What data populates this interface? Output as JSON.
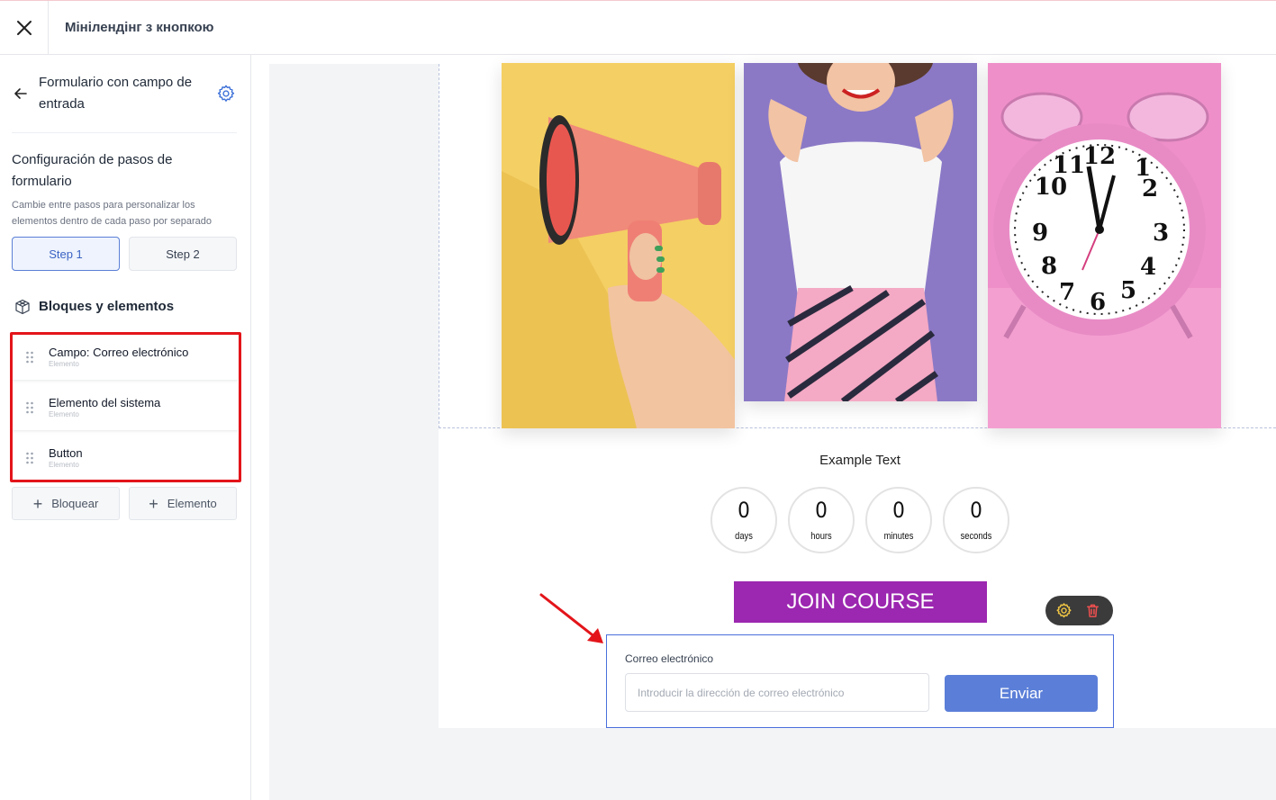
{
  "topbar": {
    "title": "Мінілендінг з кнопкою"
  },
  "sidebar": {
    "form_title": "Formulario con campo de entrada",
    "steps_heading": "Configuración de pasos de formulario",
    "steps_desc": "Cambie entre pasos para personalizar los elementos dentro de cada paso por separado",
    "steps": [
      "Step 1",
      "Step 2"
    ],
    "blocks_heading": "Bloques y elementos",
    "elements": [
      {
        "name": "Campo: Correo electrónico",
        "type": "Elemento"
      },
      {
        "name": "Elemento del sistema",
        "type": "Elemento"
      },
      {
        "name": "Button",
        "type": "Elemento"
      }
    ],
    "add_block": "Bloquear",
    "add_element": "Elemento"
  },
  "canvas": {
    "example_text": "Example Text",
    "countdown": [
      {
        "value": "0",
        "label": "days"
      },
      {
        "value": "0",
        "label": "hours"
      },
      {
        "value": "0",
        "label": "minutes"
      },
      {
        "value": "0",
        "label": "seconds"
      }
    ],
    "join_button": "JOIN COURSE",
    "form": {
      "label": "Correo electrónico",
      "placeholder": "Introducir la dirección de correo electrónico",
      "submit": "Enviar"
    },
    "colors": {
      "join_button": "#9c27b0",
      "submit": "#5b7fd8",
      "accent": "#4a6fdc",
      "highlight": "#e3151a"
    }
  }
}
